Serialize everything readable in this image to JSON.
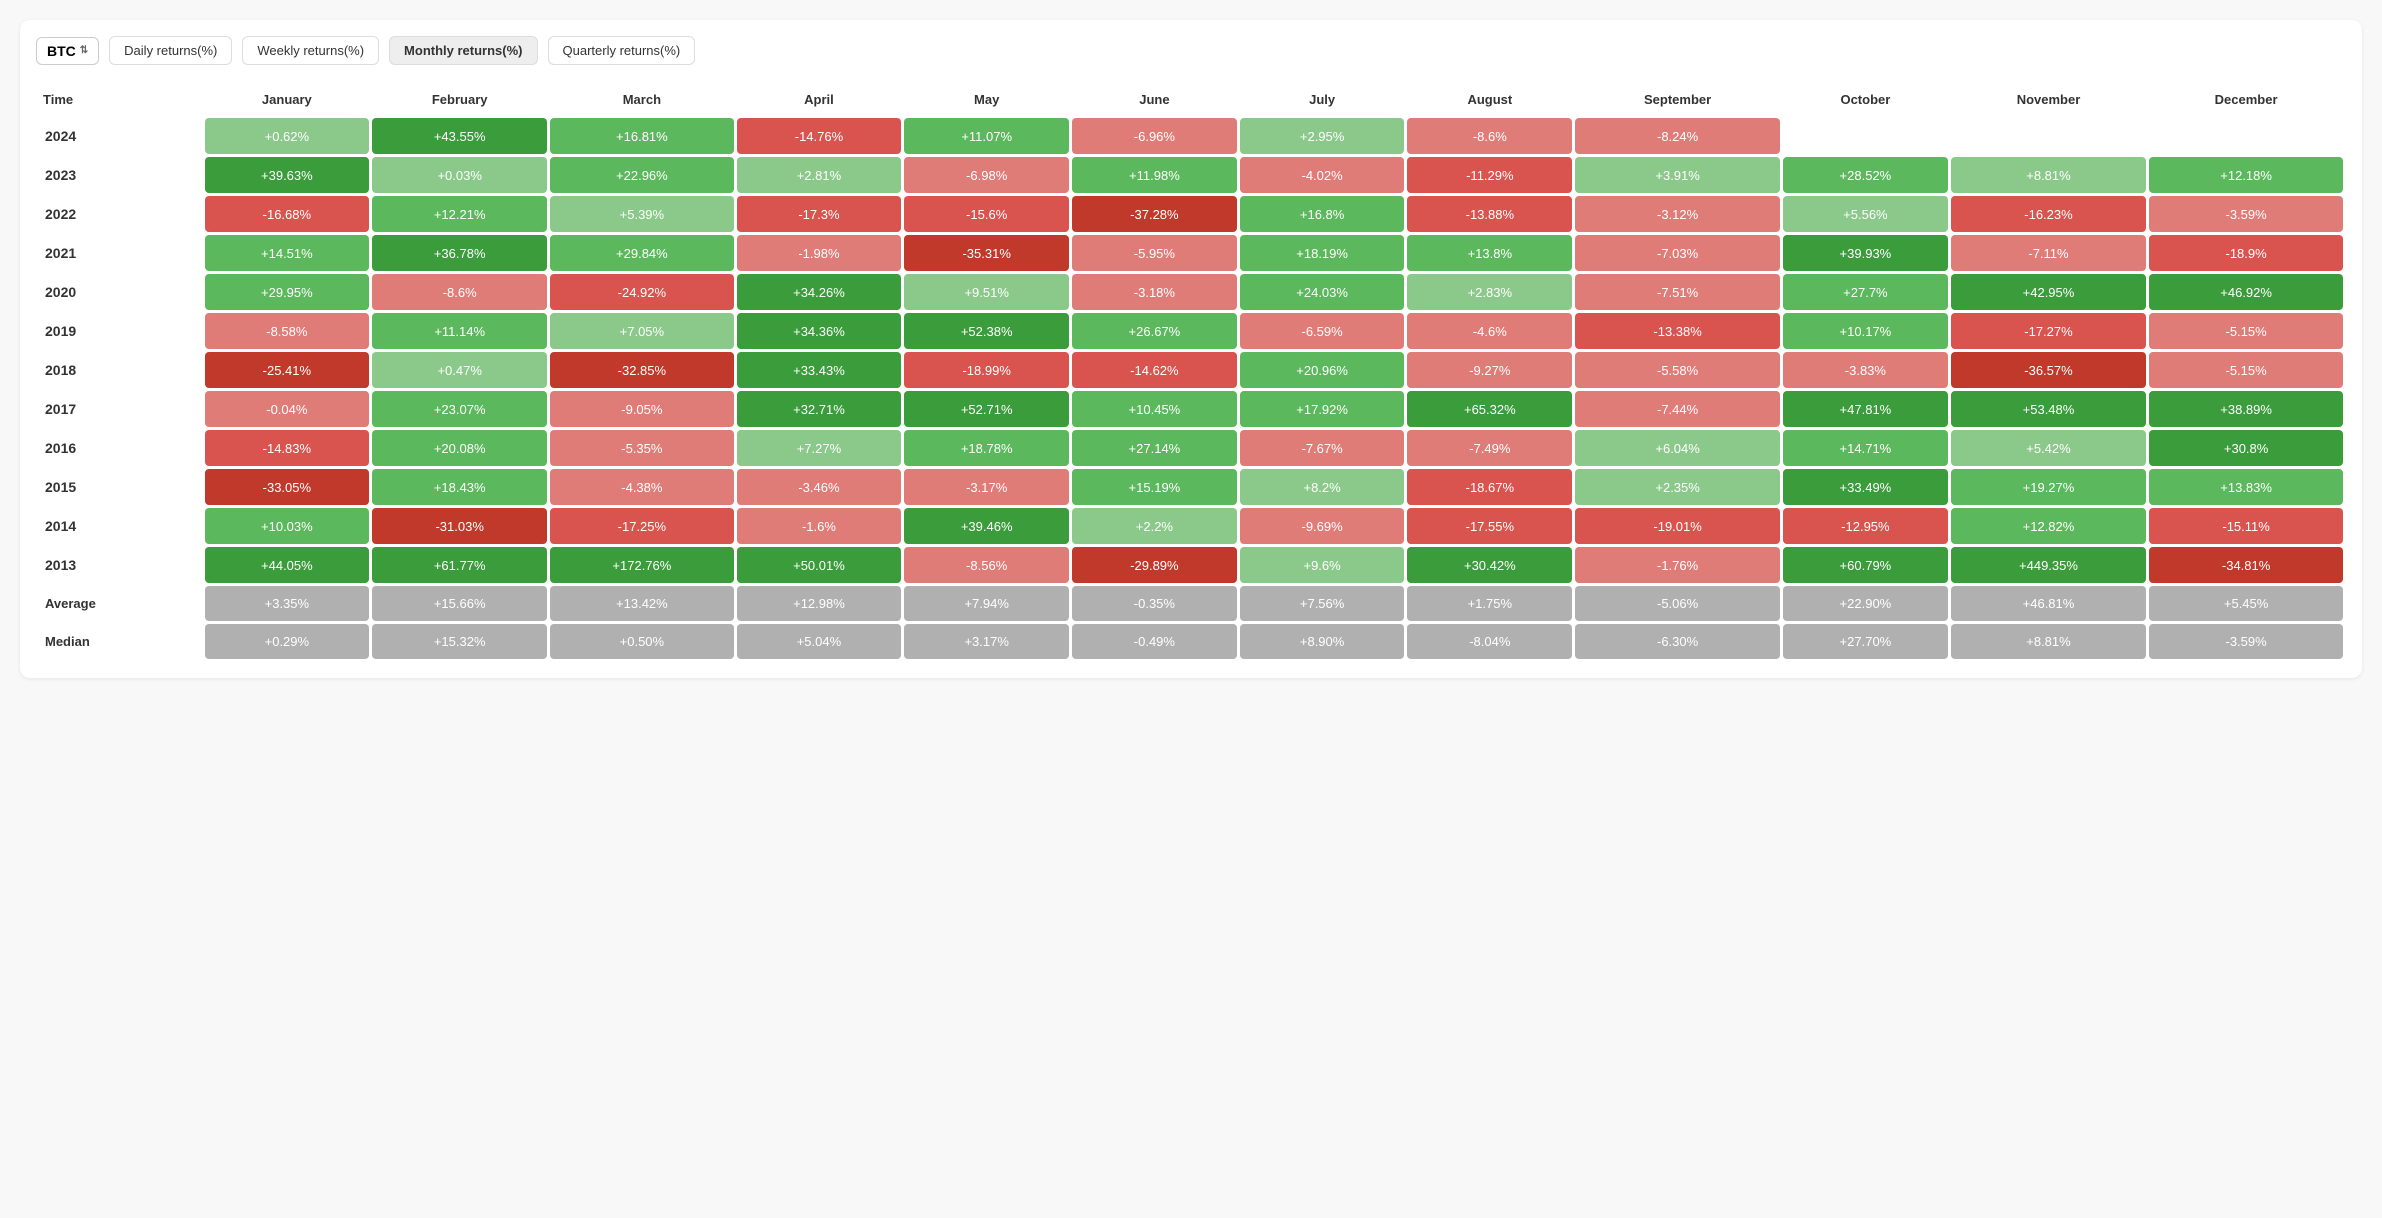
{
  "toolbar": {
    "asset": "BTC",
    "tabs": [
      {
        "label": "Daily returns(%)",
        "active": false
      },
      {
        "label": "Weekly returns(%)",
        "active": false
      },
      {
        "label": "Monthly returns(%)",
        "active": true
      },
      {
        "label": "Quarterly returns(%)",
        "active": false
      }
    ]
  },
  "table": {
    "columns": [
      "Time",
      "January",
      "February",
      "March",
      "April",
      "May",
      "June",
      "July",
      "August",
      "September",
      "October",
      "November",
      "December"
    ],
    "rows": [
      {
        "year": "2024",
        "cells": [
          "+0.62%",
          "+43.55%",
          "+16.81%",
          "-14.76%",
          "+11.07%",
          "-6.96%",
          "+2.95%",
          "-8.6%",
          "-8.24%",
          "",
          "",
          ""
        ]
      },
      {
        "year": "2023",
        "cells": [
          "+39.63%",
          "+0.03%",
          "+22.96%",
          "+2.81%",
          "-6.98%",
          "+11.98%",
          "-4.02%",
          "-11.29%",
          "+3.91%",
          "+28.52%",
          "+8.81%",
          "+12.18%"
        ]
      },
      {
        "year": "2022",
        "cells": [
          "-16.68%",
          "+12.21%",
          "+5.39%",
          "-17.3%",
          "-15.6%",
          "-37.28%",
          "+16.8%",
          "-13.88%",
          "-3.12%",
          "+5.56%",
          "-16.23%",
          "-3.59%"
        ]
      },
      {
        "year": "2021",
        "cells": [
          "+14.51%",
          "+36.78%",
          "+29.84%",
          "-1.98%",
          "-35.31%",
          "-5.95%",
          "+18.19%",
          "+13.8%",
          "-7.03%",
          "+39.93%",
          "-7.11%",
          "-18.9%"
        ]
      },
      {
        "year": "2020",
        "cells": [
          "+29.95%",
          "-8.6%",
          "-24.92%",
          "+34.26%",
          "+9.51%",
          "-3.18%",
          "+24.03%",
          "+2.83%",
          "-7.51%",
          "+27.7%",
          "+42.95%",
          "+46.92%"
        ]
      },
      {
        "year": "2019",
        "cells": [
          "-8.58%",
          "+11.14%",
          "+7.05%",
          "+34.36%",
          "+52.38%",
          "+26.67%",
          "-6.59%",
          "-4.6%",
          "-13.38%",
          "+10.17%",
          "-17.27%",
          "-5.15%"
        ]
      },
      {
        "year": "2018",
        "cells": [
          "-25.41%",
          "+0.47%",
          "-32.85%",
          "+33.43%",
          "-18.99%",
          "-14.62%",
          "+20.96%",
          "-9.27%",
          "-5.58%",
          "-3.83%",
          "-36.57%",
          "-5.15%"
        ]
      },
      {
        "year": "2017",
        "cells": [
          "-0.04%",
          "+23.07%",
          "-9.05%",
          "+32.71%",
          "+52.71%",
          "+10.45%",
          "+17.92%",
          "+65.32%",
          "-7.44%",
          "+47.81%",
          "+53.48%",
          "+38.89%"
        ]
      },
      {
        "year": "2016",
        "cells": [
          "-14.83%",
          "+20.08%",
          "-5.35%",
          "+7.27%",
          "+18.78%",
          "+27.14%",
          "-7.67%",
          "-7.49%",
          "+6.04%",
          "+14.71%",
          "+5.42%",
          "+30.8%"
        ]
      },
      {
        "year": "2015",
        "cells": [
          "-33.05%",
          "+18.43%",
          "-4.38%",
          "-3.46%",
          "-3.17%",
          "+15.19%",
          "+8.2%",
          "-18.67%",
          "+2.35%",
          "+33.49%",
          "+19.27%",
          "+13.83%"
        ]
      },
      {
        "year": "2014",
        "cells": [
          "+10.03%",
          "-31.03%",
          "-17.25%",
          "-1.6%",
          "+39.46%",
          "+2.2%",
          "-9.69%",
          "-17.55%",
          "-19.01%",
          "-12.95%",
          "+12.82%",
          "-15.11%"
        ]
      },
      {
        "year": "2013",
        "cells": [
          "+44.05%",
          "+61.77%",
          "+172.76%",
          "+50.01%",
          "-8.56%",
          "-29.89%",
          "+9.6%",
          "+30.42%",
          "-1.76%",
          "+60.79%",
          "+449.35%",
          "-34.81%"
        ]
      }
    ],
    "average": {
      "label": "Average",
      "cells": [
        "+3.35%",
        "+15.66%",
        "+13.42%",
        "+12.98%",
        "+7.94%",
        "-0.35%",
        "+7.56%",
        "+1.75%",
        "-5.06%",
        "+22.90%",
        "+46.81%",
        "+5.45%"
      ]
    },
    "median": {
      "label": "Median",
      "cells": [
        "+0.29%",
        "+15.32%",
        "+0.50%",
        "+5.04%",
        "+3.17%",
        "-0.49%",
        "+8.90%",
        "-8.04%",
        "-6.30%",
        "+27.70%",
        "+8.81%",
        "-3.59%"
      ]
    }
  }
}
